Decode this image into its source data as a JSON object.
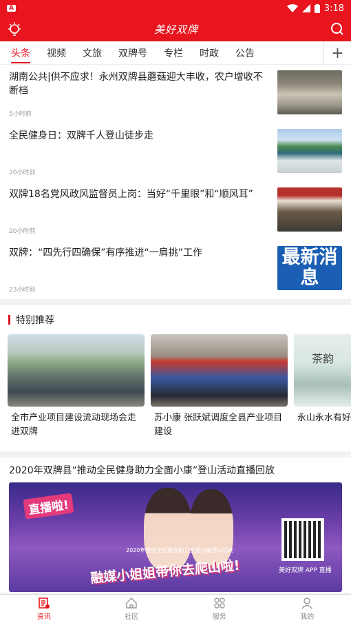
{
  "status_bar": {
    "time": "3:18",
    "notification_icon": "A"
  },
  "app": {
    "logo": "美好双牌",
    "brand_color": "#e8141e"
  },
  "tabs": [
    "头条",
    "视频",
    "文旅",
    "双牌号",
    "专栏",
    "时政",
    "公告"
  ],
  "tab_add": "+",
  "news": [
    {
      "title": "湖南公共|供不应求！永州双牌县蘑菇迎大丰收，农户增收不断档",
      "time": "5小时前"
    },
    {
      "title": "全民健身日：双牌千人登山徒步走",
      "time": "20小时前"
    },
    {
      "title": "双牌18名党风政风监督员上岗：当好“千里眼”和“顺风耳”",
      "time": "20小时前"
    },
    {
      "title": "双牌：“四先行四确保”有序推进“一肩挑”工作",
      "time": "23小时前",
      "thumb_text": "最新消息"
    }
  ],
  "special": {
    "heading": "特别推荐",
    "cards": [
      {
        "title": "全市产业项目建设流动现场会走进双牌"
      },
      {
        "title": "苏小康 张跃斌调度全县产业项目建设"
      },
      {
        "title": "永山永水有好茶 飘的双牌茶",
        "img_text": "茶韵"
      }
    ]
  },
  "live": {
    "title": "2020年双牌县“推动全民健身助力全面小康”登山活动直播回放",
    "banner_live": "直播啦!",
    "banner_sub": "2020年推动全民健身助力全面小康登山活动",
    "banner_slogan": "融媒小姐姐带你去爬山啦!",
    "banner_app": "美好双牌 APP 直播"
  },
  "bottom_nav": [
    {
      "label": "资讯",
      "icon": "news-icon",
      "active": true
    },
    {
      "label": "社区",
      "icon": "home-icon",
      "active": false
    },
    {
      "label": "服务",
      "icon": "grid-icon",
      "active": false
    },
    {
      "label": "我的",
      "icon": "user-icon",
      "active": false
    }
  ]
}
